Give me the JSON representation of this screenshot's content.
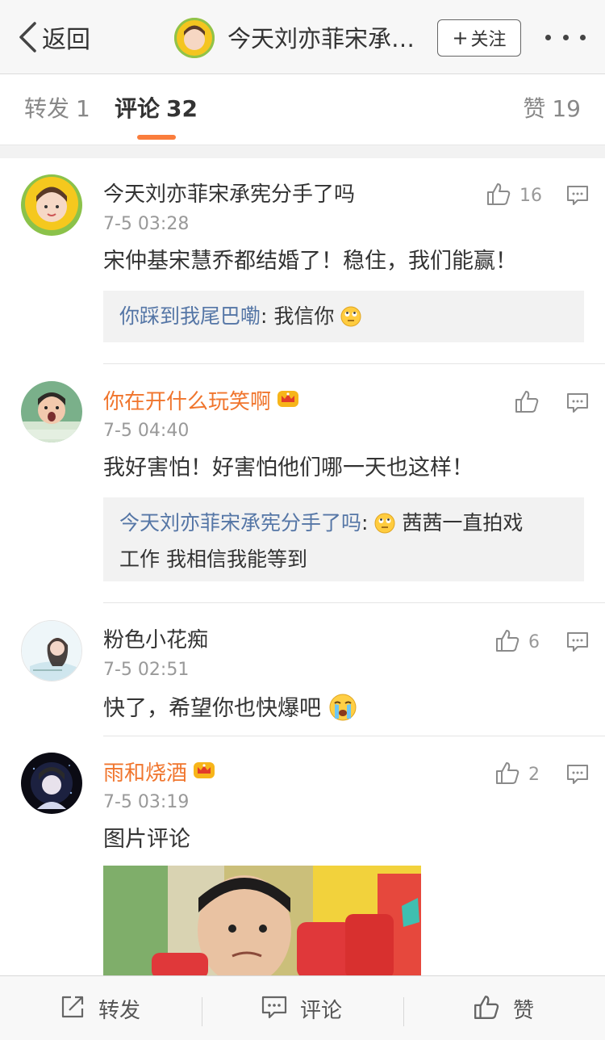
{
  "nav": {
    "back_label": "返回",
    "title": "今天刘亦菲宋承宪分手了吗",
    "follow_label": "关注"
  },
  "tabs": {
    "repost": {
      "label": "转发",
      "count": "1"
    },
    "comment": {
      "label": "评论",
      "count": "32"
    },
    "like": {
      "label": "赞",
      "count": "19"
    }
  },
  "comments": [
    {
      "user": "今天刘亦菲宋承宪分手了吗",
      "time": "7-5 03:28",
      "text": "宋仲基宋慧乔都结婚了！稳住，我们能赢！",
      "likes": "16",
      "reply": {
        "user": "你踩到我尾巴嘞",
        "text": ": 我信你"
      }
    },
    {
      "user": "你在开什么玩笑啊",
      "time": "7-5 04:40",
      "text": "我好害怕！好害怕他们哪一天也这样！",
      "likes": "",
      "reply": {
        "user": "今天刘亦菲宋承宪分手了吗",
        "text_line1": "茜茜一直拍戏",
        "text_line2": "工作 我相信我能等到"
      }
    },
    {
      "user": "粉色小花痴",
      "time": "7-5 02:51",
      "text": "快了，希望你也快爆吧",
      "likes": "6"
    },
    {
      "user": "雨和烧酒",
      "time": "7-5 03:19",
      "text": "图片评论",
      "likes": "2"
    }
  ],
  "bottom": {
    "repost_label": "转发",
    "comment_label": "评论",
    "like_label": "赞"
  },
  "colors": {
    "accent": "#fa7d3c",
    "vip_name": "#f0752d",
    "reply_user": "#5576a6"
  },
  "icons": [
    "chevron-left-icon",
    "more-icon",
    "thumbs-up-icon",
    "comment-bubble-icon",
    "share-icon",
    "crown-icon",
    "eyeroll-emoji",
    "crying-emoji"
  ]
}
